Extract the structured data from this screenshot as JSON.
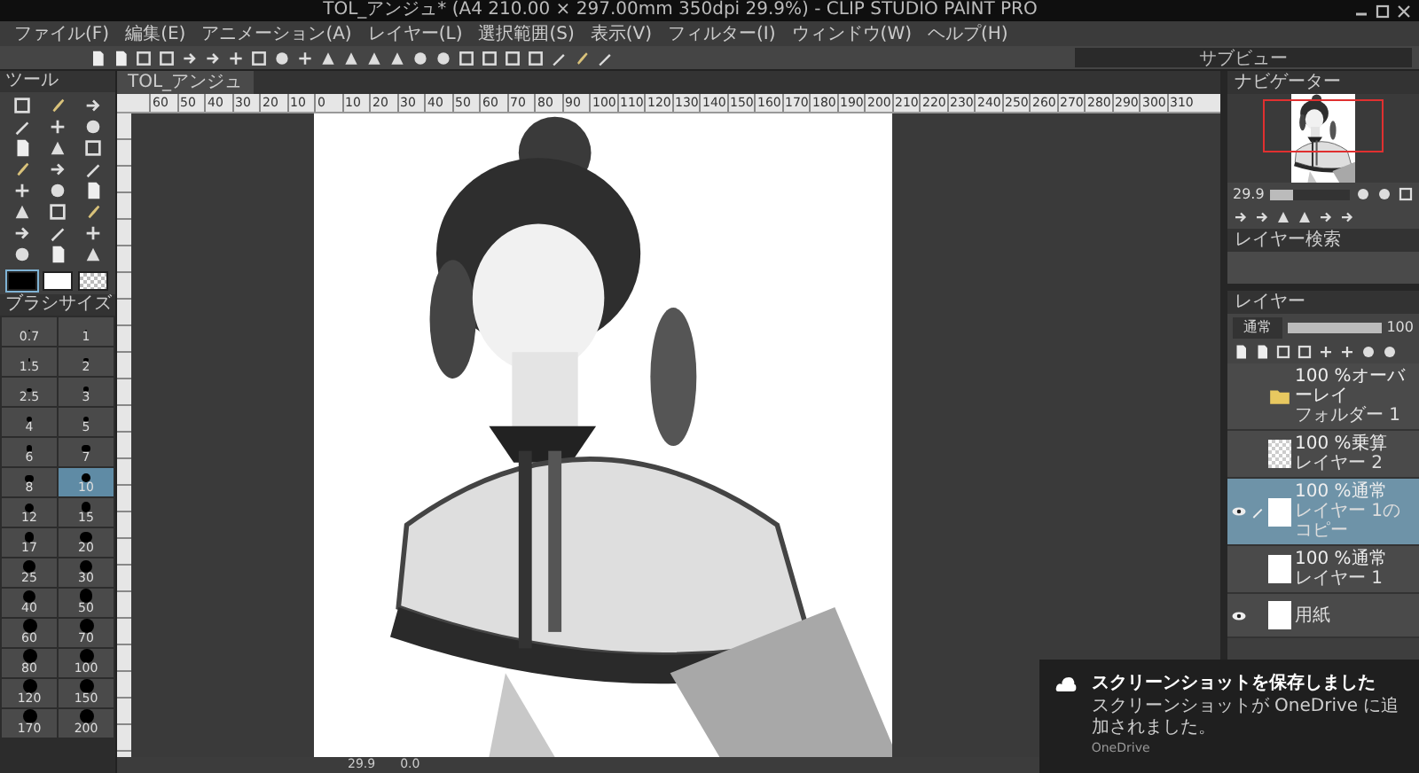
{
  "window": {
    "title": "TOL_アンジュ* (A4 210.00 × 297.00mm 350dpi 29.9%) - CLIP STUDIO PAINT PRO"
  },
  "menu": [
    "ファイル(F)",
    "編集(E)",
    "アニメーション(A)",
    "レイヤー(L)",
    "選択範囲(S)",
    "表示(V)",
    "フィルター(I)",
    "ウィンドウ(W)",
    "ヘルプ(H)"
  ],
  "sub_view": {
    "title": "サブビュー"
  },
  "tool_panel": {
    "title": "ツール"
  },
  "colors": [
    {
      "kind": "black",
      "selected": true
    },
    {
      "kind": "white",
      "selected": false
    },
    {
      "kind": "transparent",
      "selected": false
    }
  ],
  "brush_size": {
    "title": "ブラシサイズ",
    "sizes": [
      {
        "label": "0.7",
        "selected": false
      },
      {
        "label": "1",
        "selected": false
      },
      {
        "label": "1.5",
        "selected": false
      },
      {
        "label": "2",
        "selected": false
      },
      {
        "label": "2.5",
        "selected": false
      },
      {
        "label": "3",
        "selected": false
      },
      {
        "label": "4",
        "selected": false
      },
      {
        "label": "5",
        "selected": false
      },
      {
        "label": "6",
        "selected": false
      },
      {
        "label": "7",
        "selected": false
      },
      {
        "label": "8",
        "selected": false
      },
      {
        "label": "10",
        "selected": true
      },
      {
        "label": "12",
        "selected": false
      },
      {
        "label": "15",
        "selected": false
      },
      {
        "label": "17",
        "selected": false
      },
      {
        "label": "20",
        "selected": false
      },
      {
        "label": "25",
        "selected": false
      },
      {
        "label": "30",
        "selected": false
      },
      {
        "label": "40",
        "selected": false
      },
      {
        "label": "50",
        "selected": false
      },
      {
        "label": "60",
        "selected": false
      },
      {
        "label": "70",
        "selected": false
      },
      {
        "label": "80",
        "selected": false
      },
      {
        "label": "100",
        "selected": false
      },
      {
        "label": "120",
        "selected": false
      },
      {
        "label": "150",
        "selected": false
      },
      {
        "label": "170",
        "selected": false
      },
      {
        "label": "200",
        "selected": false
      }
    ]
  },
  "document_tab": {
    "title": "TOL_アンジュ"
  },
  "ruler": {
    "labels": [
      "60",
      "50",
      "40",
      "30",
      "20",
      "10",
      "0",
      "10",
      "20",
      "30",
      "40",
      "50",
      "60",
      "70",
      "80",
      "90",
      "100",
      "110",
      "120",
      "130",
      "140",
      "150",
      "160",
      "170",
      "180",
      "190",
      "200",
      "210",
      "220",
      "230",
      "240",
      "250",
      "260",
      "270",
      "280",
      "290",
      "300",
      "310"
    ]
  },
  "status_bar": {
    "zoom": "29.9",
    "angle": "0.0"
  },
  "navigator": {
    "title": "ナビゲーター",
    "zoom": "29.9",
    "zoom_slider": {
      "level": 0.3
    }
  },
  "layer_search": {
    "title": "レイヤー検索"
  },
  "layers_panel": {
    "title": "レイヤー",
    "blend_mode": "通常",
    "opacity": "100",
    "opacity_slider": {
      "level": 1
    },
    "layers": [
      {
        "kind": "folder",
        "mode": "100 %オーバーレイ",
        "name": "フォルダー 1",
        "visible": false,
        "selected": false
      },
      {
        "kind": "layer",
        "mode": "100 %乗算",
        "name": "レイヤー 2",
        "visible": false,
        "selected": false
      },
      {
        "kind": "layer",
        "mode": "100 %通常",
        "name": "レイヤー 1のコピー",
        "visible": true,
        "selected": true
      },
      {
        "kind": "layer",
        "mode": "100 %通常",
        "name": "レイヤー 1",
        "visible": false,
        "selected": false
      },
      {
        "kind": "paper",
        "name": "用紙",
        "visible": true,
        "selected": false
      }
    ]
  },
  "notification": {
    "title": "スクリーンショットを保存しました",
    "body": "スクリーンショットが OneDrive に追加されました。",
    "source": "OneDrive"
  }
}
